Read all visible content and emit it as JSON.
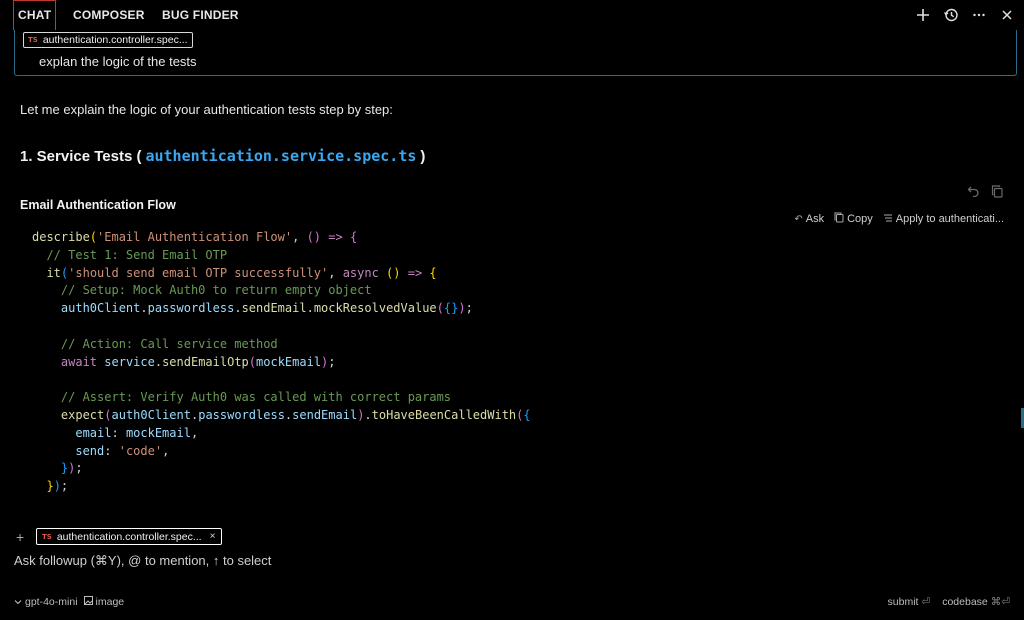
{
  "tabs": [
    {
      "label": "CHAT",
      "active": true
    },
    {
      "label": "COMPOSER",
      "active": false
    },
    {
      "label": "BUG FINDER",
      "active": false
    }
  ],
  "top_icons": [
    "plus-icon",
    "history-icon",
    "more-icon",
    "close-icon"
  ],
  "query": {
    "file_chip": {
      "badge": "TS",
      "name": "authentication.controller.spec..."
    },
    "text": "explan the logic of the tests"
  },
  "response": {
    "intro": "Let me explain the logic of your authentication tests step by step:",
    "heading": {
      "prefix": "1. Service Tests (",
      "file": "authentication.service.spec.ts",
      "suffix": ")"
    },
    "subheading": "Email Authentication Flow",
    "code_actions": {
      "ask": "Ask",
      "copy": "Copy",
      "apply": "Apply to authenticati..."
    }
  },
  "input": {
    "file_chip": {
      "badge": "TS",
      "name": "authentication.controller.spec...",
      "close": "×"
    },
    "placeholder": "Ask followup (⌘Y), @ to mention, ↑ to select"
  },
  "footer": {
    "model": "gpt-4o-mini",
    "image_label": "image",
    "submit_label": "submit",
    "submit_shortcut": "⏎",
    "codebase_label": "codebase",
    "codebase_shortcut": "⌘⏎"
  },
  "colors": {
    "accent_tab": "#c0392b",
    "file_link": "#3ba7f0",
    "query_border": "#2c6b8a"
  }
}
